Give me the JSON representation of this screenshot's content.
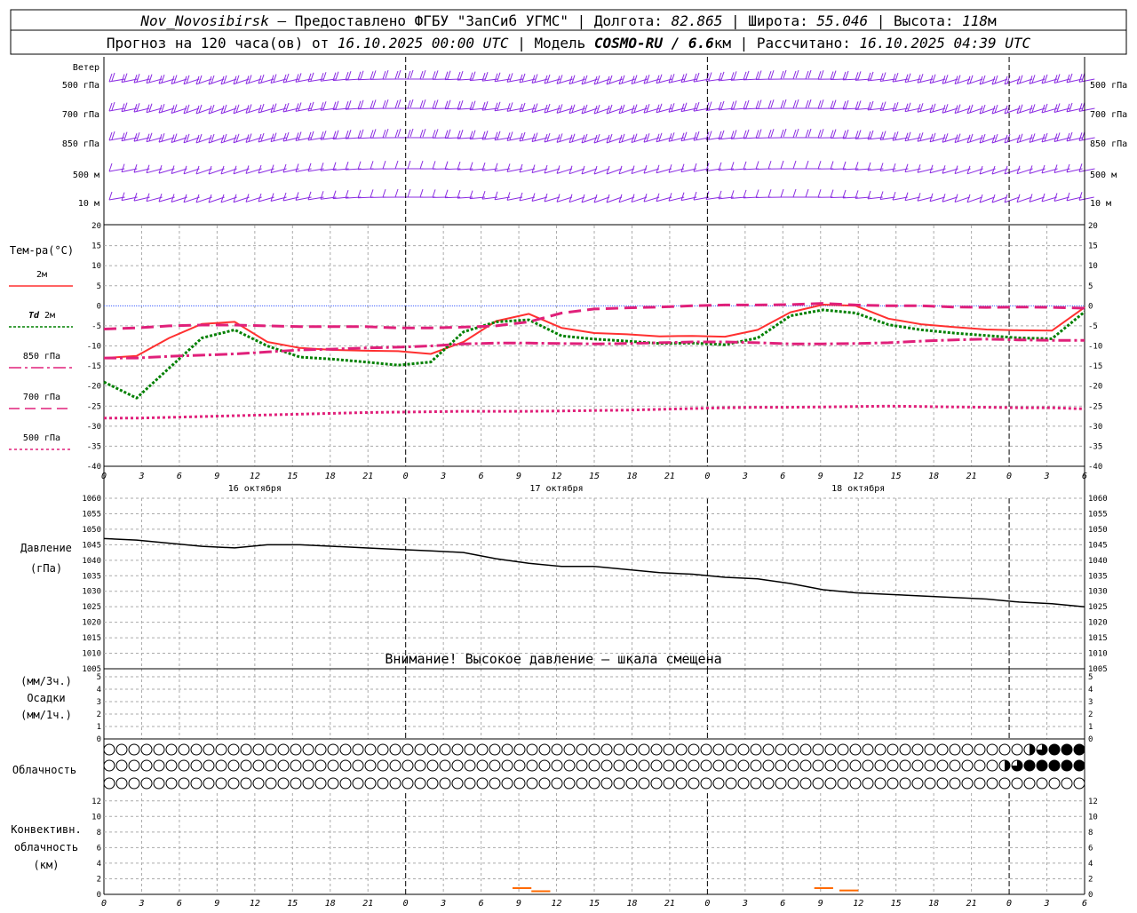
{
  "header": {
    "line1": {
      "station": "Nov_Novosibirsk",
      "provider": " – Предоставлено ФГБУ \"ЗапСиб УГМС\" | ",
      "lon_label": "Долгота: ",
      "lon": "82.865",
      "lat_label": " | Широта: ",
      "lat": "55.046",
      "alt_label": " | Высота: ",
      "alt": "118",
      "alt_unit": "м"
    },
    "line2": {
      "prefix": "Прогноз на 120 часа(ов) от ",
      "start": "16.10.2025 00:00 UTC",
      "model_label": "  | Модель ",
      "model": "COSMO-RU / 6.6",
      "model_unit": "км",
      "calc_label": " | Рассчитано: ",
      "calc": "16.10.2025 04:39 UTC"
    }
  },
  "wind_panel": {
    "title": "Ветер",
    "levels": [
      "500 гПа",
      "700 гПа",
      "850 гПа",
      "500 м",
      "10  м"
    ],
    "color": "#8a2be2"
  },
  "temp_panel": {
    "title": "Тем-ра(°С)",
    "yticks": [
      20,
      15,
      10,
      5,
      0,
      -5,
      -10,
      -15,
      -20,
      -25,
      -30,
      -35,
      -40
    ],
    "legend": [
      {
        "label": "2м",
        "italic": "",
        "color": "#ff3030",
        "dash": ""
      },
      {
        "label": " 2м",
        "italic": "Td",
        "color": "#008000",
        "dash": "3,2"
      },
      {
        "label": "850 гПа",
        "italic": "",
        "color": "#e0207a",
        "dash": "14,4,3,4"
      },
      {
        "label": "700 гПа",
        "italic": "",
        "color": "#e0207a",
        "dash": "12,6"
      },
      {
        "label": "500 гПа",
        "italic": "",
        "color": "#e0207a",
        "dash": "3,3"
      }
    ]
  },
  "time_axis": {
    "ticks": [
      "0",
      "3",
      "6",
      "9",
      "12",
      "15",
      "18",
      "21",
      "0",
      "3",
      "6",
      "9",
      "12",
      "15",
      "18",
      "21",
      "0",
      "3",
      "6",
      "9",
      "12",
      "15",
      "18",
      "21",
      "0",
      "3",
      "6"
    ],
    "days": [
      "16 октября",
      "17 октября",
      "18 октября"
    ]
  },
  "pressure_panel": {
    "title": "Давление",
    "unit": "(гПа)",
    "warning": "Внимание! Высокое давление – шкала смещена",
    "yticks": [
      1060,
      1055,
      1050,
      1045,
      1040,
      1035,
      1030,
      1025,
      1020,
      1015,
      1010,
      1005
    ]
  },
  "precip_panel": {
    "unit_top": "(мм/3ч.)",
    "title": "Осадки",
    "unit_bottom": "(мм/1ч.)",
    "yticks": [
      5,
      4,
      3,
      2,
      1,
      0
    ]
  },
  "cloud_panel": {
    "title": "Облачность"
  },
  "conv_panel": {
    "title_line1": "Конвективн.",
    "title_line2": "облачность",
    "unit": "(км)",
    "yticks": [
      12,
      10,
      8,
      6,
      4,
      2,
      0
    ]
  },
  "chart_data": {
    "type": "line",
    "x_hours": [
      0,
      3,
      6,
      9,
      12,
      15,
      18,
      21,
      24,
      27,
      30,
      33,
      36,
      39,
      42,
      45,
      48,
      51,
      54,
      57,
      60,
      63,
      66,
      69,
      72,
      75,
      78
    ],
    "temperature": {
      "ylim": [
        -40,
        20
      ],
      "series": [
        {
          "name": "2м",
          "values": [
            -13,
            -12.5,
            -8,
            -4.5,
            -4,
            -9,
            -10.5,
            -11,
            -11.2,
            -11.3,
            -12,
            -9,
            -3.8,
            -2,
            -5.5,
            -6.8,
            -7.1,
            -7.6,
            -7.5,
            -7.7,
            -6,
            -1.6,
            0.3,
            0,
            -3.2,
            -4.6,
            -5.3,
            -5.9,
            -6.1,
            -6.2,
            -0.4
          ]
        },
        {
          "name": "Td 2м",
          "values": [
            -19,
            -23,
            -15.5,
            -8,
            -6,
            -10,
            -12.8,
            -13.3,
            -14,
            -14.8,
            -14,
            -6.5,
            -4,
            -3.5,
            -7.5,
            -8.3,
            -8.8,
            -9.4,
            -9.3,
            -9.7,
            -8,
            -2.5,
            -1,
            -1.8,
            -4.7,
            -6,
            -6.8,
            -7.4,
            -8,
            -8.2,
            -1.5
          ]
        },
        {
          "name": "850 гПа",
          "values": [
            -13,
            -13,
            -12.6,
            -12.3,
            -12,
            -11.5,
            -11,
            -10.8,
            -10.5,
            -10.3,
            -10,
            -9.5,
            -9.3,
            -9.3,
            -9.4,
            -9.5,
            -9.4,
            -9.2,
            -9,
            -9,
            -9.2,
            -9.5,
            -9.5,
            -9.4,
            -9.2,
            -8.8,
            -8.5,
            -8.3,
            -8.5,
            -8.6,
            -8.6
          ]
        },
        {
          "name": "700 гПа",
          "values": [
            -5.8,
            -5.5,
            -5,
            -4.8,
            -4.8,
            -5,
            -5.2,
            -5.2,
            -5.2,
            -5.5,
            -5.5,
            -5.3,
            -5,
            -4,
            -1.8,
            -0.8,
            -0.5,
            -0.3,
            0,
            0.2,
            0.2,
            0.3,
            0.6,
            0.2,
            0,
            0,
            -0.3,
            -0.4,
            -0.3,
            -0.4,
            -0.6
          ]
        },
        {
          "name": "500 гПа",
          "values": [
            -28,
            -28,
            -27.8,
            -27.6,
            -27.4,
            -27.2,
            -27,
            -26.8,
            -26.6,
            -26.5,
            -26.4,
            -26.3,
            -26.3,
            -26.3,
            -26.2,
            -26.1,
            -26,
            -25.8,
            -25.6,
            -25.4,
            -25.3,
            -25.3,
            -25.2,
            -25.1,
            -25,
            -25.1,
            -25.2,
            -25.3,
            -25.4,
            -25.4,
            -25.7
          ]
        }
      ]
    },
    "pressure": {
      "ylim": [
        1005,
        1060
      ],
      "name": "Давление",
      "values": [
        1047,
        1046.5,
        1045.5,
        1044.5,
        1044,
        1045,
        1045,
        1044.5,
        1044,
        1043.5,
        1043,
        1042.5,
        1040.5,
        1039,
        1038,
        1038,
        1037,
        1036,
        1035.5,
        1034.5,
        1034,
        1032.5,
        1030.5,
        1029.5,
        1029,
        1028.5,
        1028,
        1027.5,
        1026.5,
        1026,
        1025
      ]
    },
    "precipitation": {
      "ylim": [
        0,
        5
      ],
      "values": []
    },
    "cloud_cover": {
      "rows": 3,
      "upper_start_hour": 72,
      "upper_fill": [
        0,
        0,
        0.5,
        0.75,
        1,
        1,
        1
      ],
      "middle_start_hour": 72,
      "middle_fill": [
        0.5,
        0.75,
        1,
        1,
        1,
        1,
        1
      ]
    },
    "convective": {
      "ylim": [
        0,
        13
      ],
      "segments": [
        {
          "hour_start": 32.5,
          "hour_end": 34,
          "value": 0.8
        },
        {
          "hour_start": 34,
          "hour_end": 35.5,
          "value": 0.4
        },
        {
          "hour_start": 56.5,
          "hour_end": 58,
          "value": 0.8
        },
        {
          "hour_start": 58.5,
          "hour_end": 60,
          "value": 0.5
        }
      ],
      "color": "#ff6a00"
    }
  }
}
